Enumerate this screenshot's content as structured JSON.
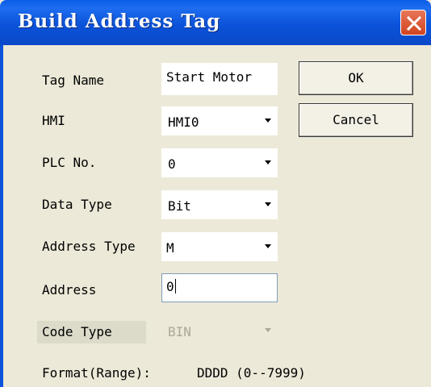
{
  "window": {
    "title": "Build Address Tag",
    "close_icon": "close-icon"
  },
  "form": {
    "tag_name_label": "Tag Name",
    "tag_name_value": "Start Motor",
    "hmi_label": "HMI",
    "hmi_value": "HMI0",
    "plc_no_label": "PLC No.",
    "plc_no_value": "0",
    "data_type_label": "Data Type",
    "data_type_value": "Bit",
    "address_type_label": "Address Type",
    "address_type_value": "M",
    "address_label": "Address",
    "address_value": "0",
    "code_type_label": "Code Type",
    "code_type_value": "BIN",
    "format_label": "Format(Range):",
    "format_value": "DDDD (0--7999)"
  },
  "buttons": {
    "ok": "OK",
    "cancel": "Cancel"
  },
  "colors": {
    "titlebar": "#0b53d9",
    "dialog_bg": "#ece9d8",
    "close_button": "#d1441f"
  }
}
